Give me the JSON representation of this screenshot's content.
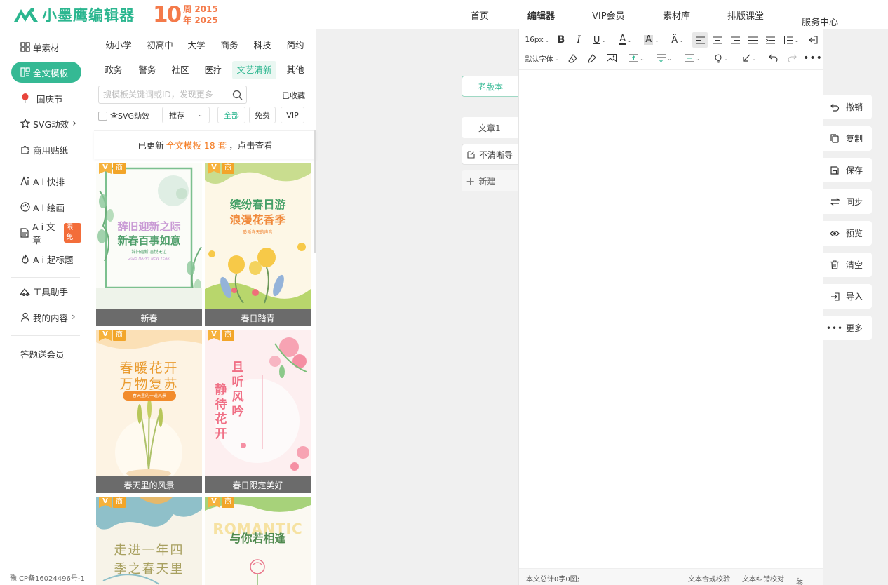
{
  "header": {
    "logo_text": "小墨鹰编辑器",
    "anniv_ten": "10",
    "anniv_line1": "周 2015",
    "anniv_line2": "年 2025",
    "nav": [
      {
        "label": "首页",
        "active": false
      },
      {
        "label": "编辑器",
        "active": true
      },
      {
        "label": "VIP会员",
        "active": false
      },
      {
        "label": "素材库",
        "active": false
      },
      {
        "label": "排版课堂",
        "active": false
      },
      {
        "label": "服务中心",
        "active": false
      }
    ]
  },
  "sidebar": {
    "items": [
      {
        "label": "单素材",
        "icon": "grid-icon"
      },
      {
        "label": "全文模板",
        "icon": "template-icon",
        "active": true
      },
      {
        "label": "国庆节",
        "icon": "balloon-icon"
      },
      {
        "label": "SVG动效",
        "icon": "star-icon",
        "arrow": "›"
      },
      {
        "label": "商用贴纸",
        "icon": "puzzle-icon"
      },
      {
        "label": "A i 快排",
        "icon": "ai-layout-icon"
      },
      {
        "label": "A i 绘画",
        "icon": "palette-icon"
      },
      {
        "label": "A i 文章",
        "icon": "document-icon",
        "badge": "限免"
      },
      {
        "label": "A i 起标题",
        "icon": "flame-icon"
      },
      {
        "label": "工具助手",
        "icon": "tools-icon"
      },
      {
        "label": "我的内容",
        "icon": "user-icon",
        "arrow": "›"
      },
      {
        "label": "答题送会员",
        "icon": ""
      }
    ],
    "icp": "豫ICP备16024496号-1"
  },
  "panel": {
    "categories_row1": [
      "幼小学",
      "初高中",
      "大学",
      "商务",
      "科技",
      "简约"
    ],
    "categories_row2": [
      "政务",
      "警务",
      "社区",
      "医疗",
      "文艺清新",
      "其他"
    ],
    "active_category": "文艺清新",
    "search_placeholder": "搜模板关键词或ID，发现更多",
    "favorites": "已收藏",
    "svg_filter": "含SVG动效",
    "sort": "推荐",
    "filters": [
      "全部",
      "免费",
      "VIP"
    ],
    "notice_prefix": "已更新",
    "notice_highlight": "全文模板 18 套",
    "notice_suffix": "，点击查看",
    "badge_v": "V",
    "badge_shang": "商",
    "cards": [
      {
        "label": "新春",
        "title1": "辞旧迎新之际",
        "title2": "新春百事如意",
        "sub": "辞旧迎新 喜悦无边",
        "sub2": "2025 HAPPY NEW YEAR"
      },
      {
        "label": "春日踏青",
        "title1": "缤纷春日游",
        "title2": "浪漫花香季",
        "sub": "聆听春天的声音"
      },
      {
        "label": "春天里的风景",
        "title1": "春暖花开",
        "title2": "万物复苏",
        "sub": "春天里的一道风景"
      },
      {
        "label": "春日限定美好",
        "col1": "且听风吟",
        "col2": "静待花开"
      },
      {
        "label": "",
        "title1": "走进一年四",
        "title2": "季之春天里"
      },
      {
        "label": "",
        "title1": "ROMANTIC",
        "title2": "与你若相逢"
      }
    ]
  },
  "docs": {
    "old_version": "老版本",
    "tab": "文章1",
    "guide": "不清晰导",
    "new": "新建"
  },
  "editor": {
    "font_size": "16px",
    "font_family": "默认字体",
    "footer_count": "本文总计0字0图;",
    "footer_check": "文本合规校验",
    "footer_proof": "文本纠错校对",
    "footer_sign": "签名"
  },
  "actions": [
    {
      "label": "撤销",
      "icon": "undo-icon"
    },
    {
      "label": "复制",
      "icon": "copy-icon"
    },
    {
      "label": "保存",
      "icon": "save-icon"
    },
    {
      "label": "同步",
      "icon": "sync-icon"
    },
    {
      "label": "预览",
      "icon": "eye-icon"
    },
    {
      "label": "清空",
      "icon": "trash-icon"
    },
    {
      "label": "导入",
      "icon": "import-icon"
    },
    {
      "label": "更多",
      "icon": "more-icon"
    }
  ],
  "colors": {
    "brand": "#2bb68f",
    "accent_orange": "#f47a4a",
    "active_bg": "#35b994"
  }
}
